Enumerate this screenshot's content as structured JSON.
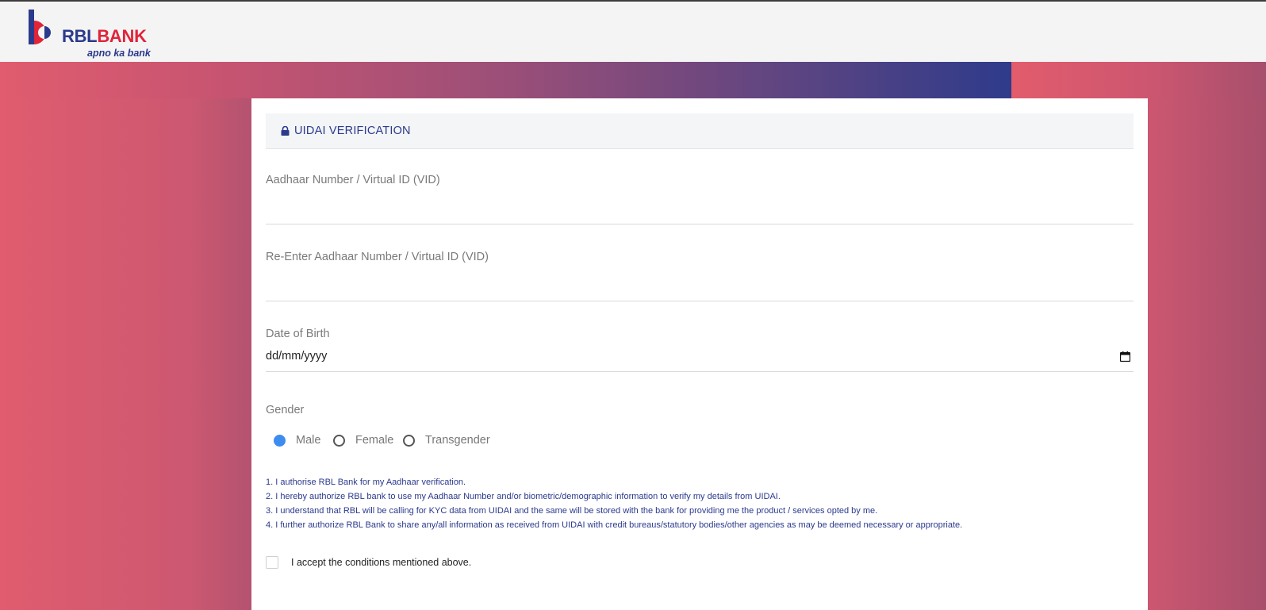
{
  "brand": {
    "name_part1": "RBL",
    "name_part2": "BANK",
    "tagline": "apno ka bank"
  },
  "form": {
    "title": "UIDAI VERIFICATION",
    "aadhaar": {
      "label": "Aadhaar Number / Virtual ID (VID)",
      "value": ""
    },
    "reenter_aadhaar": {
      "label": "Re-Enter Aadhaar Number / Virtual ID (VID)",
      "value": ""
    },
    "dob": {
      "label": "Date of Birth",
      "placeholder": "dd/mm/yyyy"
    },
    "gender": {
      "label": "Gender",
      "options": [
        {
          "label": "Male",
          "checked": true
        },
        {
          "label": "Female",
          "checked": false
        },
        {
          "label": "Transgender",
          "checked": false
        }
      ]
    },
    "terms": [
      "1. I authorise RBL Bank for my Aadhaar verification.",
      "2. I hereby authorize RBL bank to use my Aadhaar Number and/or biometric/demographic information to verify my details from UIDAI.",
      "3. I understand that RBL will be calling for KYC data from UIDAI and the same will be stored with the bank for providing me the product / services opted by me.",
      "4. I further authorize RBL Bank to share any/all information as received from UIDAI with credit bureaus/statutory bodies/other agencies as may be deemed necessary or appropriate."
    ],
    "accept": {
      "label": "I accept the conditions mentioned above.",
      "checked": false
    }
  },
  "colors": {
    "brand_blue": "#2b3a8c",
    "brand_red": "#e0243a",
    "radio_checked": "#3d8cf0"
  },
  "icons": {
    "logo": "rbl-logo-mark",
    "lock": "lock-icon",
    "calendar": "calendar-icon"
  }
}
